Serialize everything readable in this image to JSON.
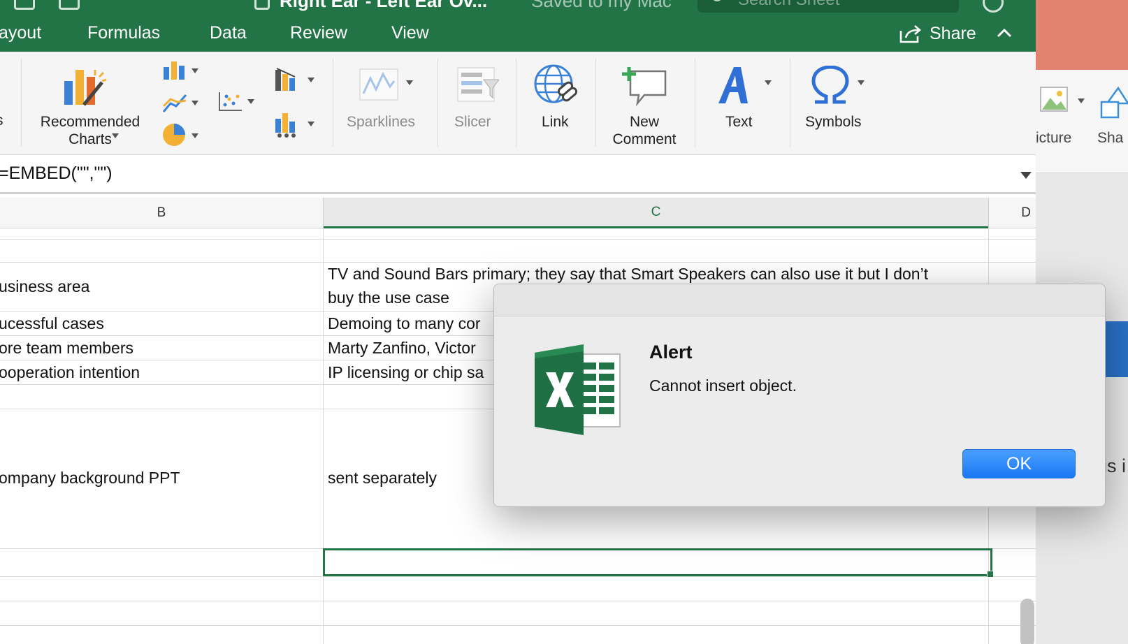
{
  "app": {
    "title": "Right Ear - Left Ear Ov...",
    "save_status": "Saved to my Mac",
    "search_placeholder": "Search Sheet"
  },
  "tabs": [
    {
      "label": "ayout"
    },
    {
      "label": "Formulas"
    },
    {
      "label": "Data"
    },
    {
      "label": "Review"
    },
    {
      "label": "View"
    }
  ],
  "share": {
    "label": "Share"
  },
  "ribbon": {
    "left_fragment": "s",
    "recommended_charts": {
      "line1": "Recommended",
      "line2": "Charts"
    },
    "sparklines": "Sparklines",
    "slicer": "Slicer",
    "link": "Link",
    "new_comment": {
      "line1": "New",
      "line2": "Comment"
    },
    "text": "Text",
    "symbols": "Symbols"
  },
  "formula_bar": {
    "content": "=EMBED(\"\",\"\")"
  },
  "columns": {
    "b": "B",
    "c": "C",
    "d": "D"
  },
  "rows": [
    {
      "b": "",
      "c": ""
    },
    {
      "b": "usiness area",
      "c_line1": "TV and Sound Bars primary; they say that Smart Speakers can also use it but I don’t",
      "c_line2": "buy the use case"
    },
    {
      "b": "ucessful cases",
      "c": "Demoing to many cor"
    },
    {
      "b": "ore team members",
      "c": "Marty Zanfino, Victor"
    },
    {
      "b": "ooperation intention",
      "c": "IP licensing or chip sa"
    },
    {
      "b": "",
      "c": ""
    },
    {
      "b": "ompany background PPT",
      "c": "sent separately"
    }
  ],
  "alert": {
    "title": "Alert",
    "message": "Cannot insert object.",
    "ok_label": "OK"
  },
  "background_window": {
    "ribbon_label_1": "icture",
    "ribbon_label_2": "Sha",
    "doc_text": "is i"
  },
  "colors": {
    "excel_green": "#227447",
    "ok_blue": "#1a78f2",
    "ppt_orange": "#e08470"
  }
}
